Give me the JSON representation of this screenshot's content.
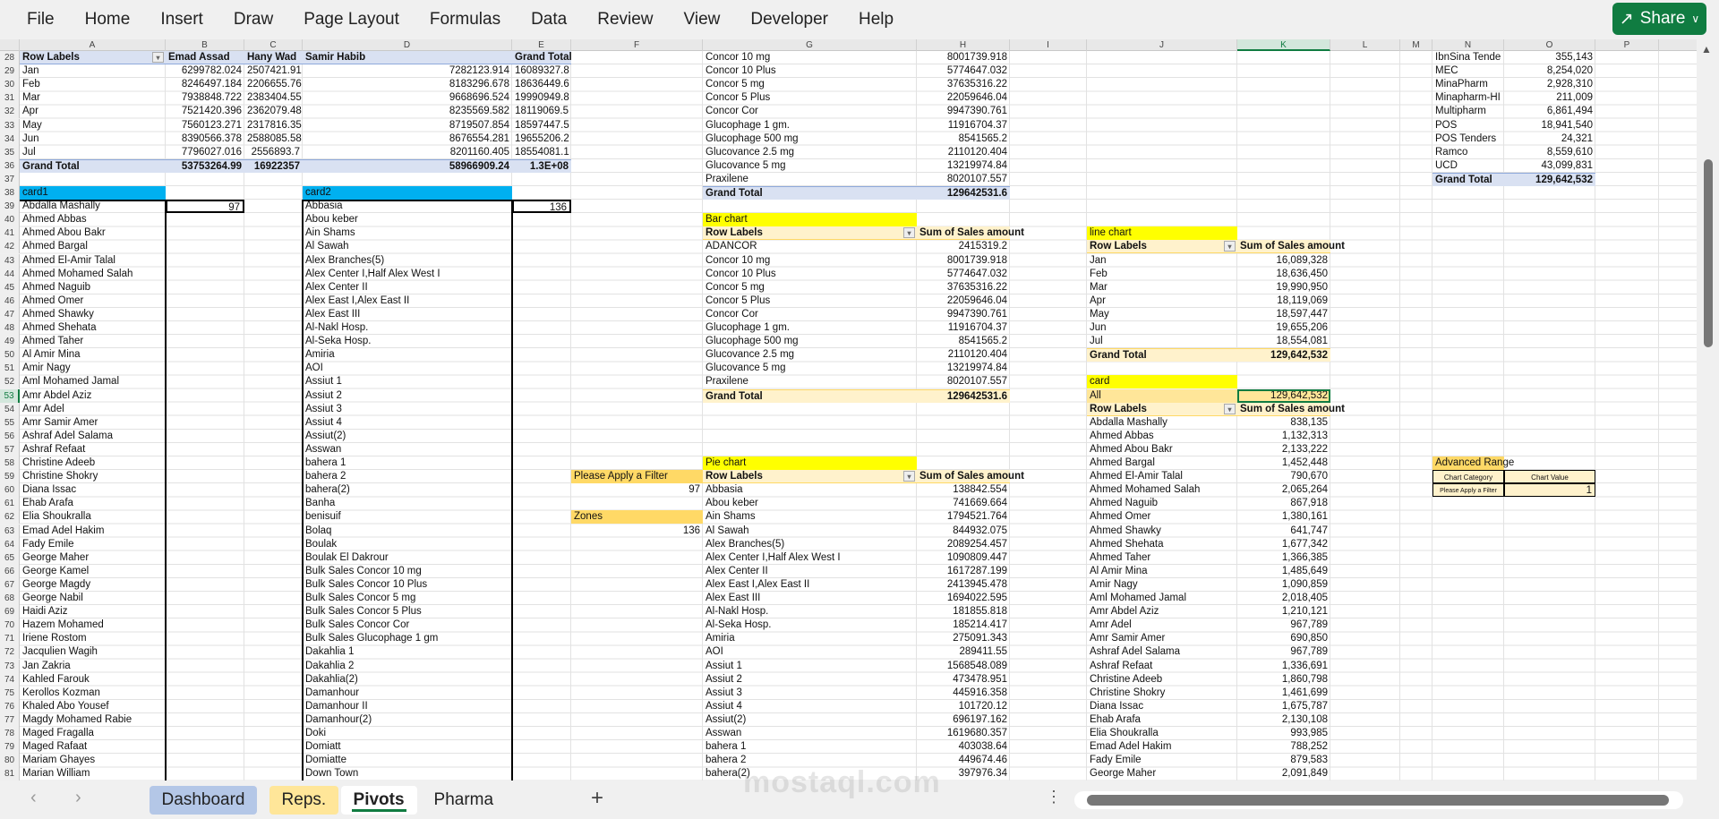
{
  "menu": [
    "File",
    "Home",
    "Insert",
    "Draw",
    "Page Layout",
    "Formulas",
    "Data",
    "Review",
    "View",
    "Developer",
    "Help"
  ],
  "share_label": "Share",
  "columns": [
    "A",
    "B",
    "C",
    "D",
    "E",
    "F",
    "G",
    "H",
    "I",
    "J",
    "K",
    "L",
    "M",
    "N",
    "O",
    "P"
  ],
  "row_numbers": [
    28,
    29,
    30,
    31,
    32,
    33,
    34,
    35,
    36,
    37,
    38,
    39,
    40,
    41,
    42,
    43,
    44,
    45,
    46,
    47,
    48,
    49,
    50,
    51,
    52,
    53,
    54,
    55,
    56,
    57,
    58,
    59,
    60,
    61,
    62,
    63,
    64,
    65,
    66,
    67,
    68,
    69,
    70,
    71,
    72,
    73,
    74,
    75,
    76,
    77,
    78,
    79,
    80,
    81
  ],
  "selected_cell": {
    "column": "K",
    "row": 53
  },
  "rep_pivot": {
    "headers": [
      "Row Labels",
      "Emad Assad",
      "Hany Wad",
      "Samir Habib",
      "Grand Total"
    ],
    "rows": [
      {
        "label": "Jan",
        "values": [
          "6299782.024",
          "2507421.91",
          "7282123.914",
          "16089327.8"
        ]
      },
      {
        "label": "Feb",
        "values": [
          "8246497.184",
          "2206655.76",
          "8183296.678",
          "18636449.6"
        ]
      },
      {
        "label": "Mar",
        "values": [
          "7938848.722",
          "2383404.55",
          "9668696.524",
          "19990949.8"
        ]
      },
      {
        "label": "Apr",
        "values": [
          "7521420.396",
          "2362079.48",
          "8235569.582",
          "18119069.5"
        ]
      },
      {
        "label": "May",
        "values": [
          "7560123.271",
          "2317816.35",
          "8719507.854",
          "18597447.5"
        ]
      },
      {
        "label": "Jun",
        "values": [
          "8390566.378",
          "2588085.58",
          "8676554.281",
          "19655206.2"
        ]
      },
      {
        "label": "Jul",
        "values": [
          "7796027.016",
          "2556893.7",
          "8201160.405",
          "18554081.1"
        ]
      }
    ],
    "grand_total": {
      "label": "Grand Total",
      "values": [
        "53753264.99",
        "16922357",
        "58966909.24",
        "1.3E+08"
      ]
    }
  },
  "card1": {
    "title": "card1",
    "count": "97",
    "names": [
      "Abdalla Mashally",
      "Ahmed Abbas",
      "Ahmed Abou Bakr",
      "Ahmed Bargal",
      "Ahmed El-Amir Talal",
      "Ahmed Mohamed Salah",
      "Ahmed Naguib",
      "Ahmed Omer",
      "Ahmed Shawky",
      "Ahmed Shehata",
      "Ahmed Taher",
      "Al Amir Mina",
      "Amir Nagy",
      "Aml Mohamed Jamal",
      "Amr Abdel Aziz",
      "Amr Adel",
      "Amr Samir Amer",
      "Ashraf Adel Salama",
      "Ashraf Refaat",
      "Christine Adeeb",
      "Christine Shokry",
      "Diana Issac",
      "Ehab Arafa",
      "Elia Shoukralla",
      "Emad Adel Hakim",
      "Fady Emile",
      "George  Maher",
      "George Kamel",
      "George Magdy",
      "George Nabil",
      "Haidi Aziz",
      "Hazem Mohamed",
      "Iriene Rostom",
      "Jacqulien Wagih",
      "Jan Zakria",
      "Kahled Farouk",
      "Kerollos Kozman",
      "Khaled Abo Yousef",
      "Magdy Mohamed Rabie",
      "Maged Fragalla",
      "Maged Rafaat",
      "Mariam Ghayes",
      "Marian William"
    ]
  },
  "card2": {
    "title": "card2",
    "count": "136",
    "zones": [
      "Abbasia",
      "Abou keber",
      "Ain Shams",
      "Al Sawah",
      "Alex Branches(5)",
      "Alex Center I,Half Alex West I",
      "Alex Center II",
      "Alex East I,Alex East II",
      "Alex East III",
      "Al-Nakl Hosp.",
      "Al-Seka Hosp.",
      "Amiria",
      "AOI",
      "Assiut 1",
      "Assiut 2",
      "Assiut 3",
      "Assiut 4",
      "Assiut(2)",
      "Asswan",
      "bahera 1",
      "bahera 2",
      "bahera(2)",
      "Banha",
      "benisuif",
      "Bolaq",
      "Boulak",
      "Boulak El Dakrour",
      "Bulk Sales Concor 10 mg",
      "Bulk Sales Concor 10 Plus",
      "Bulk Sales Concor 5 mg",
      "Bulk Sales Concor 5 Plus",
      "Bulk Sales Concor Cor",
      "Bulk Sales Glucophage 1 gm",
      "Dakahlia 1",
      "Dakahlia 2",
      "Dakahlia(2)",
      "Damanhour",
      "Damanhour II",
      "Damanhour(2)",
      "Doki",
      "Domiatt",
      "Domiatte",
      "Down Town"
    ]
  },
  "product_pivot_top": {
    "rows": [
      {
        "label": "Concor 10 mg",
        "value": "8001739.918"
      },
      {
        "label": "Concor 10 Plus",
        "value": "5774647.032"
      },
      {
        "label": "Concor 5 mg",
        "value": "37635316.22"
      },
      {
        "label": "Concor 5 Plus",
        "value": "22059646.04"
      },
      {
        "label": "Concor Cor",
        "value": "9947390.761"
      },
      {
        "label": "Glucophage 1 gm.",
        "value": "11916704.37"
      },
      {
        "label": "Glucophage 500 mg",
        "value": "8541565.2"
      },
      {
        "label": "Glucovance 2.5 mg",
        "value": "2110120.404"
      },
      {
        "label": "Glucovance 5 mg",
        "value": "13219974.84"
      },
      {
        "label": "Praxilene",
        "value": "8020107.557"
      }
    ],
    "grand_total": {
      "label": "Grand Total",
      "value": "129642531.6"
    }
  },
  "bar_chart": {
    "title": "Bar chart",
    "header": [
      "Row Labels",
      "Sum of Sales amount"
    ],
    "rows": [
      {
        "label": "ADANCOR",
        "value": "2415319.2"
      },
      {
        "label": "Concor 10 mg",
        "value": "8001739.918"
      },
      {
        "label": "Concor 10 Plus",
        "value": "5774647.032"
      },
      {
        "label": "Concor 5 mg",
        "value": "37635316.22"
      },
      {
        "label": "Concor 5 Plus",
        "value": "22059646.04"
      },
      {
        "label": "Concor Cor",
        "value": "9947390.761"
      },
      {
        "label": "Glucophage 1 gm.",
        "value": "11916704.37"
      },
      {
        "label": "Glucophage 500 mg",
        "value": "8541565.2"
      },
      {
        "label": "Glucovance 2.5 mg",
        "value": "2110120.404"
      },
      {
        "label": "Glucovance 5 mg",
        "value": "13219974.84"
      },
      {
        "label": "Praxilene",
        "value": "8020107.557"
      }
    ],
    "grand_total": {
      "label": "Grand Total",
      "value": "129642531.6"
    }
  },
  "filter_panel": {
    "filter_label": "Please Apply a Filter",
    "filter_value": "97",
    "zones_label": "Zones",
    "zones_value": "136"
  },
  "pie_chart": {
    "title": "Pie chart",
    "header": [
      "Row Labels",
      "Sum of Sales amount"
    ],
    "rows": [
      {
        "label": "Abbasia",
        "value": "138842.554"
      },
      {
        "label": "Abou keber",
        "value": "741669.664"
      },
      {
        "label": "Ain Shams",
        "value": "1794521.764"
      },
      {
        "label": "Al Sawah",
        "value": "844932.075"
      },
      {
        "label": "Alex Branches(5)",
        "value": "2089254.457"
      },
      {
        "label": "Alex Center I,Half Alex West I",
        "value": "1090809.447"
      },
      {
        "label": "Alex Center II",
        "value": "1617287.199"
      },
      {
        "label": "Alex East I,Alex East II",
        "value": "2413945.478"
      },
      {
        "label": "Alex East III",
        "value": "1694022.595"
      },
      {
        "label": "Al-Nakl Hosp.",
        "value": "181855.818"
      },
      {
        "label": "Al-Seka Hosp.",
        "value": "185214.417"
      },
      {
        "label": "Amiria",
        "value": "275091.343"
      },
      {
        "label": "AOI",
        "value": "289411.55"
      },
      {
        "label": "Assiut 1",
        "value": "1568548.089"
      },
      {
        "label": "Assiut 2",
        "value": "473478.951"
      },
      {
        "label": "Assiut 3",
        "value": "445916.358"
      },
      {
        "label": "Assiut 4",
        "value": "101720.12"
      },
      {
        "label": "Assiut(2)",
        "value": "696197.162"
      },
      {
        "label": "Asswan",
        "value": "1619680.357"
      },
      {
        "label": "bahera 1",
        "value": "403038.64"
      },
      {
        "label": "bahera 2",
        "value": "449674.46"
      },
      {
        "label": "bahera(2)",
        "value": "397976.34"
      }
    ]
  },
  "line_chart": {
    "title": "line chart",
    "header": [
      "Row Labels",
      "Sum of Sales amount"
    ],
    "rows": [
      {
        "label": "Jan",
        "value": "16,089,328"
      },
      {
        "label": "Feb",
        "value": "18,636,450"
      },
      {
        "label": "Mar",
        "value": "19,990,950"
      },
      {
        "label": "Apr",
        "value": "18,119,069"
      },
      {
        "label": "May",
        "value": "18,597,447"
      },
      {
        "label": "Jun",
        "value": "19,655,206"
      },
      {
        "label": "Jul",
        "value": "18,554,081"
      }
    ],
    "grand_total": {
      "label": "Grand Total",
      "value": "129,642,532"
    }
  },
  "card": {
    "title": "card",
    "all_label": "All",
    "all_value": "129,642,532",
    "header": [
      "Row Labels",
      "Sum of Sales amount"
    ],
    "rows": [
      {
        "label": "Abdalla Mashally",
        "value": "838,135"
      },
      {
        "label": "Ahmed Abbas",
        "value": "1,132,313"
      },
      {
        "label": "Ahmed Abou Bakr",
        "value": "2,133,222"
      },
      {
        "label": "Ahmed Bargal",
        "value": "1,452,448"
      },
      {
        "label": "Ahmed El-Amir Talal",
        "value": "790,670"
      },
      {
        "label": "Ahmed Mohamed Salah",
        "value": "2,065,264"
      },
      {
        "label": "Ahmed Naguib",
        "value": "867,918"
      },
      {
        "label": "Ahmed Omer",
        "value": "1,380,161"
      },
      {
        "label": "Ahmed Shawky",
        "value": "641,747"
      },
      {
        "label": "Ahmed Shehata",
        "value": "1,677,342"
      },
      {
        "label": "Ahmed Taher",
        "value": "1,366,385"
      },
      {
        "label": "Al Amir Mina",
        "value": "1,485,649"
      },
      {
        "label": "Amir Nagy",
        "value": "1,090,859"
      },
      {
        "label": "Aml Mohamed Jamal",
        "value": "2,018,405"
      },
      {
        "label": "Amr Abdel Aziz",
        "value": "1,210,121"
      },
      {
        "label": "Amr Adel",
        "value": "967,789"
      },
      {
        "label": "Amr Samir Amer",
        "value": "690,850"
      },
      {
        "label": "Ashraf Adel Salama",
        "value": "967,789"
      },
      {
        "label": "Ashraf Refaat",
        "value": "1,336,691"
      },
      {
        "label": "Christine Adeeb",
        "value": "1,860,798"
      },
      {
        "label": "Christine Shokry",
        "value": "1,461,699"
      },
      {
        "label": "Diana Issac",
        "value": "1,675,787"
      },
      {
        "label": "Ehab Arafa",
        "value": "2,130,108"
      },
      {
        "label": "Elia Shoukralla",
        "value": "993,985"
      },
      {
        "label": "Emad Adel Hakim",
        "value": "788,252"
      },
      {
        "label": "Fady Emile",
        "value": "879,583"
      },
      {
        "label": "George  Maher",
        "value": "2,091,849"
      }
    ]
  },
  "customer_pivot": {
    "rows": [
      {
        "label": "IbnSina Tende",
        "value": "355,143"
      },
      {
        "label": "MEC",
        "value": "8,254,020"
      },
      {
        "label": "MinaPharm",
        "value": "2,928,310"
      },
      {
        "label": "Minapharm-HI",
        "value": "211,009"
      },
      {
        "label": "Multipharm",
        "value": "6,861,494"
      },
      {
        "label": "POS",
        "value": "18,941,540"
      },
      {
        "label": "POS Tenders",
        "value": "24,321"
      },
      {
        "label": "Ramco",
        "value": "8,559,610"
      },
      {
        "label": "UCD",
        "value": "43,099,831"
      }
    ],
    "grand_total": {
      "label": "Grand Total",
      "value": "129,642,532"
    }
  },
  "advanced_range": {
    "title": "Advanced Range",
    "headers": [
      "Chart Category",
      "Chart Value"
    ],
    "row": [
      "Please Apply a Filter",
      "1"
    ]
  },
  "sheet_tabs": [
    {
      "label": "Dashboard",
      "color": "#b4c7e7"
    },
    {
      "label": "Reps.",
      "color": "#ffe699"
    },
    {
      "label": "Pivots",
      "active": true
    },
    {
      "label": "Pharma"
    }
  ],
  "watermark": "mostaql.com"
}
